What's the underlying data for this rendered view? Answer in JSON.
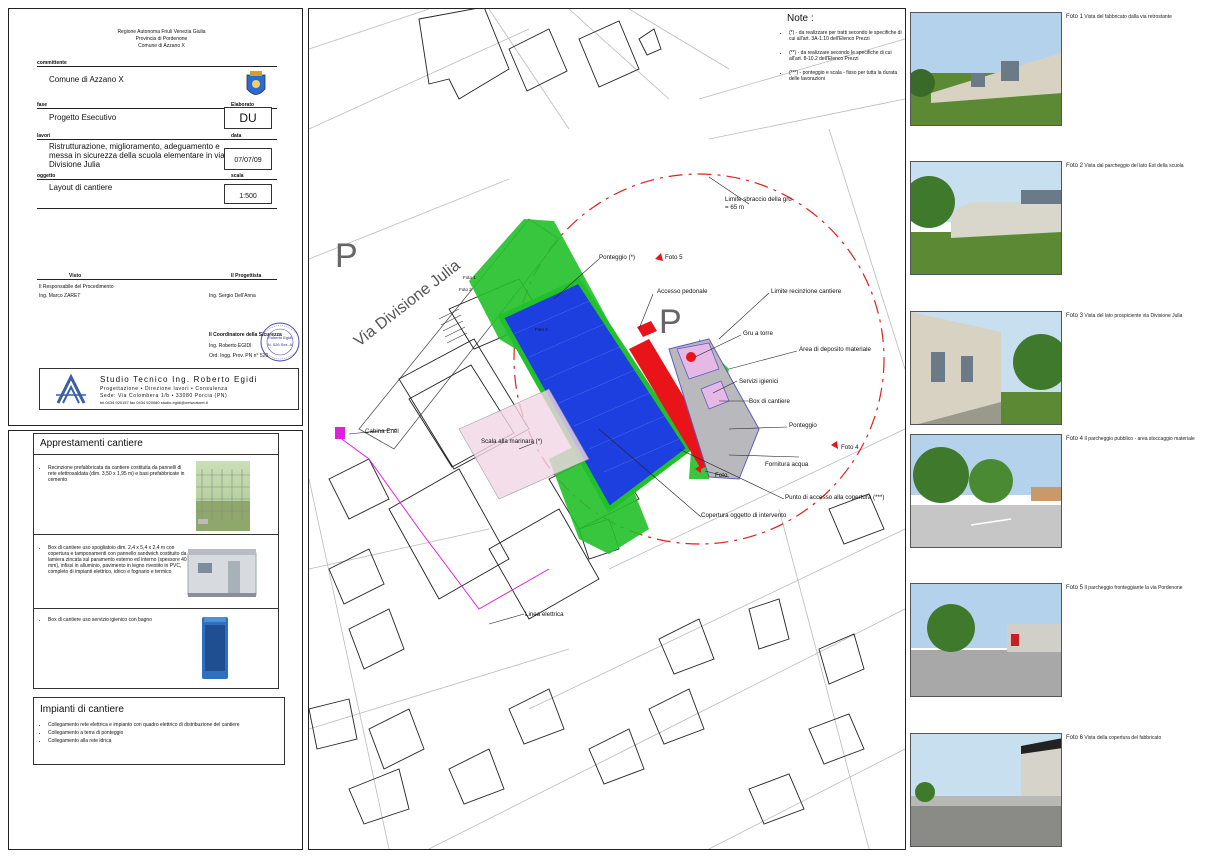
{
  "header": {
    "region": "Regione Autonoma Friuli Venezia Giulia",
    "province": "Provincia di Pordenone",
    "municipality": "Comune di Azzano X",
    "client_head": "committente",
    "client": "Comune di Azzano X",
    "phase_head": "fase",
    "phase": "Progetto Esecutivo",
    "code_head": "Elaborato",
    "code": "DU",
    "desc_head": "lavori",
    "desc": "Ristrutturazione, miglioramento, adeguamento e messa in sicurezza della scuola elementare in via Divisione Julia",
    "date_head": "data",
    "date": "07/07/09",
    "subject_head": "oggetto",
    "subject": "Layout di cantiere",
    "scale_head": "scala",
    "scale": "1:500",
    "visto_head": "Visto",
    "progettista_head": "Il Progettista",
    "visto_sub": "Il Responsabile del Procedimento",
    "visto_name": "Ing. Marco ZARET",
    "progettista_name": "Ing. Sergio Dell'Anna",
    "coord_head": "Il Coordinatore della Sicurezza",
    "coord_name": "Ing. Roberto EGIDI",
    "coord_reg": "Ord. Ingg. Prov. PN n° 526",
    "stamp_text": "ORDINE DEGLI INGEGNERI DELLA PROV. DI PORDENONE",
    "stamp_name": "Roberto Egidi",
    "stamp_id": "N. 526 Sez. A",
    "studio_name": "Studio Tecnico Ing. Roberto Egidi",
    "studio_services": "Progettazione • Direzione lavori • Consulenza",
    "studio_address": "Sede: Via Colombera 1/b • 33080 Porcia (PN)",
    "studio_contacts": "tel.0434 920157 fax 0434 920080 studio.egidi@networknet.it"
  },
  "apprestamenti": {
    "title": "Apprestamenti cantiere",
    "items": [
      {
        "text": "Recinzione prefabbricata da cantiere costituita da pannelli di rete elettrosaldata (dim. 3,50 x 1,95 m) e basi prefabbricate in cemento"
      },
      {
        "text": "Box di cantiere uso spogliatoio dim. 2,4 x 5,4 x 2,4 m con copertura e tamponamenti con pannello sandwich costituito da lamiera zincata sul paramento esterno ed interno (spessore 40 mm), infissi in alluminio, pavimento in legno rivestito in PVC, completo di impianti elettrico, idrico e fognario e termico"
      },
      {
        "text": "Box di cantiere uso servizio igienico con bagno"
      }
    ]
  },
  "impianti": {
    "title": "Impianti di cantiere",
    "items": [
      "Collegamento rete elettrica e impianto con quadro elettrico di distribuzione del cantiere",
      "Collegamento a terra di ponteggio",
      "Collegamento alla rete idrica"
    ]
  },
  "note": {
    "title": "Note :",
    "items": [
      "(*) - da realizzare per tratti secondo le specifiche di cui all'art. 3A-1.10 dell'Elenco Prezzi",
      "(**) - da realizzare secondo le specifiche di cui all'art. 8-10.2 dell'Elenco Prezzi",
      "(***) - ponteggio e scala - fisso per tutta la durata delle lavorazioni"
    ]
  },
  "map_labels": {
    "street": "Via Divisione Julia",
    "parking": "P",
    "crane_radius": "Limite sbraccio della gru",
    "crane_radius_value": "= 65 m",
    "ponteggio_star": "Ponteggio (*)",
    "foto5": "Foto 5",
    "accesso_pedonale": "Accesso pedonale",
    "limite_recinzione": "Limite recinzione cantiere",
    "gru": "Gru a torre",
    "area_deposito": "Area di deposito materiale",
    "servizi": "Servizi igienici",
    "box": "Box di cantiere",
    "ponteggio": "Ponteggio",
    "foto4": "Foto 4",
    "fornitura": "Fornitura acqua",
    "foto": "Foto",
    "punto_accesso": "Punto di accesso alla copertura (***)",
    "copertura": "Copertura oggetto di intervento",
    "scala": "Scala alla marinara (*)",
    "cabina": "Cabina Enel",
    "linea": "Linea elettrica",
    "foto1_tag": "Foto 1",
    "foto2_tag": "Foto 2",
    "foto3_tag": "Foto 3"
  },
  "photos": [
    {
      "label": "Foto 1",
      "caption": "Vista del fabbricato dalla via retrostante"
    },
    {
      "label": "Foto 2",
      "caption": "Vista dal parcheggio del lato Est della scuola"
    },
    {
      "label": "Foto 3",
      "caption": "Vista del lato prospiciente via Divisione Julia"
    },
    {
      "label": "Foto 4",
      "caption": "Il parcheggio pubblico - area stoccaggio materiale"
    },
    {
      "label": "Foto 5",
      "caption": "Il parcheggio fronteggiante la via Pordenone"
    },
    {
      "label": "Foto 6",
      "caption": "Vista della copertura del fabbricato"
    }
  ],
  "colors": {
    "green": "#22c02a",
    "blue": "#1d3fe0",
    "red": "#e8141a",
    "magenta": "#e020e0",
    "crane_circle": "#e02020"
  }
}
